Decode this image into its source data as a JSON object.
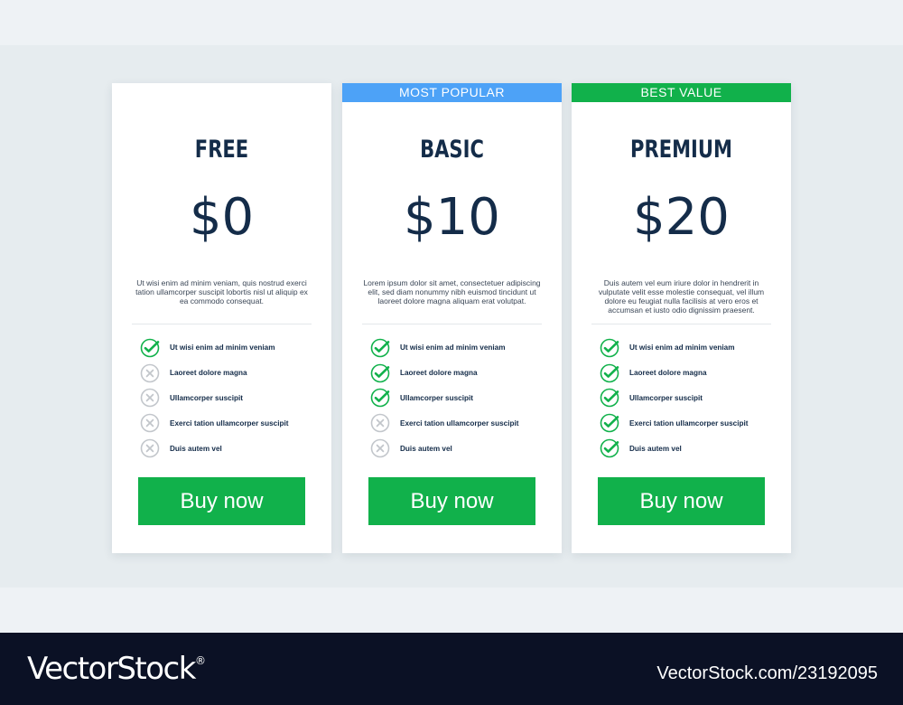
{
  "colors": {
    "accent_green": "#11b14b",
    "popular_blue": "#4da2f7",
    "navy_text": "#142c49",
    "cross_grey": "#c2c6cb"
  },
  "plans": [
    {
      "name": "FREE",
      "price": "$0",
      "ribbon": "",
      "description": "Ut wisi enim ad minim veniam, quis nostrud exerci tation ullamcorper suscipit lobortis nisl ut aliquip ex ea commodo consequat.",
      "features": [
        {
          "label": "Ut wisi enim ad minim veniam",
          "included": true,
          "icon": "check-icon"
        },
        {
          "label": "Laoreet dolore magna",
          "included": false,
          "icon": "cross-icon"
        },
        {
          "label": "Ullamcorper suscipit",
          "included": false,
          "icon": "cross-icon"
        },
        {
          "label": "Exerci tation ullamcorper suscipit",
          "included": false,
          "icon": "cross-icon"
        },
        {
          "label": "Duis autem vel",
          "included": false,
          "icon": "cross-icon"
        }
      ],
      "button": "Buy now"
    },
    {
      "name": "BASIC",
      "price": "$10",
      "ribbon": "MOST POPULAR",
      "ribbon_color": "#4da2f7",
      "description": "Lorem ipsum dolor sit amet, consectetuer adipiscing elit, sed diam nonummy nibh euismod tincidunt ut laoreet dolore magna aliquam erat volutpat.",
      "features": [
        {
          "label": "Ut wisi enim ad minim veniam",
          "included": true,
          "icon": "check-icon"
        },
        {
          "label": "Laoreet dolore magna",
          "included": true,
          "icon": "check-icon"
        },
        {
          "label": "Ullamcorper suscipit",
          "included": true,
          "icon": "check-icon"
        },
        {
          "label": "Exerci tation ullamcorper suscipit",
          "included": false,
          "icon": "cross-icon"
        },
        {
          "label": "Duis autem vel",
          "included": false,
          "icon": "cross-icon"
        }
      ],
      "button": "Buy now"
    },
    {
      "name": "PREMIUM",
      "price": "$20",
      "ribbon": "BEST VALUE",
      "ribbon_color": "#11b14b",
      "description": "Duis autem vel eum iriure dolor in hendrerit in vulputate velit esse molestie consequat, vel illum dolore eu feugiat nulla facilisis at vero eros et accumsan et iusto odio dignissim praesent.",
      "features": [
        {
          "label": "Ut wisi enim ad minim veniam",
          "included": true,
          "icon": "check-icon"
        },
        {
          "label": "Laoreet dolore magna",
          "included": true,
          "icon": "check-icon"
        },
        {
          "label": "Ullamcorper suscipit",
          "included": true,
          "icon": "check-icon"
        },
        {
          "label": "Exerci tation ullamcorper suscipit",
          "included": true,
          "icon": "check-icon"
        },
        {
          "label": "Duis autem vel",
          "included": true,
          "icon": "check-icon"
        }
      ],
      "button": "Buy now"
    }
  ],
  "footer": {
    "logo": "VectorStock",
    "logo_mark": "®",
    "credit": "VectorStock.com/23192095"
  }
}
